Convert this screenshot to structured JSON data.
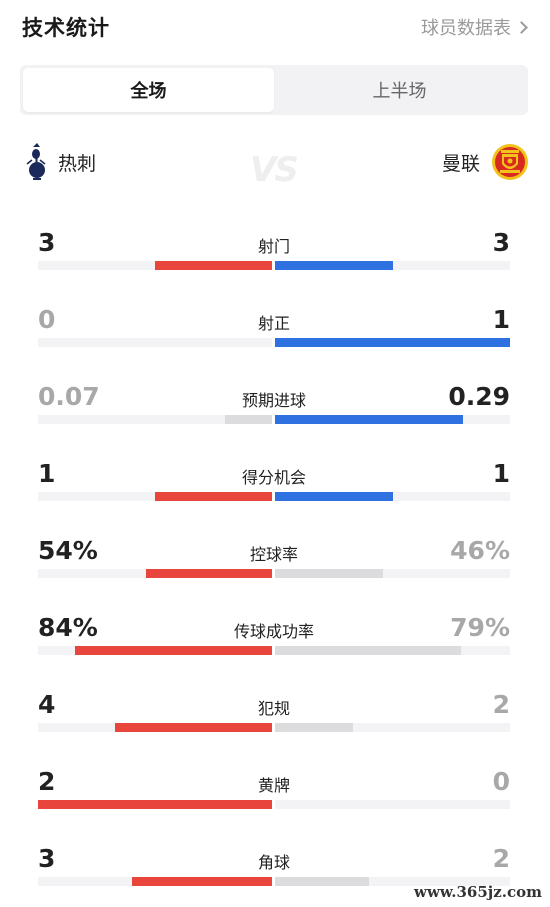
{
  "header": {
    "title": "技术统计",
    "players_link": "球员数据表"
  },
  "tabs": [
    {
      "label": "全场",
      "active": true
    },
    {
      "label": "上半场",
      "active": false
    }
  ],
  "teams": {
    "home": "热刺",
    "away": "曼联",
    "vs": "VS"
  },
  "colors": {
    "home_win": "#e8453c",
    "away_win": "#2f71e0",
    "lose_bar": "#dcdcdf",
    "win_text": "#222222",
    "lose_text": "#a8a8a8"
  },
  "stats": [
    {
      "label": "射门",
      "home": "3",
      "away": "3",
      "home_frac": 0.5,
      "away_frac": 0.5,
      "lead": "tie"
    },
    {
      "label": "射正",
      "home": "0",
      "away": "1",
      "home_frac": 0.0,
      "away_frac": 1.0,
      "lead": "away"
    },
    {
      "label": "预期进球",
      "home": "0.07",
      "away": "0.29",
      "home_frac": 0.2,
      "away_frac": 0.8,
      "lead": "away"
    },
    {
      "label": "得分机会",
      "home": "1",
      "away": "1",
      "home_frac": 0.5,
      "away_frac": 0.5,
      "lead": "tie"
    },
    {
      "label": "控球率",
      "home": "54%",
      "away": "46%",
      "home_frac": 0.54,
      "away_frac": 0.46,
      "lead": "home"
    },
    {
      "label": "传球成功率",
      "home": "84%",
      "away": "79%",
      "home_frac": 0.84,
      "away_frac": 0.79,
      "lead": "home"
    },
    {
      "label": "犯规",
      "home": "4",
      "away": "2",
      "home_frac": 0.67,
      "away_frac": 0.33,
      "lead": "home"
    },
    {
      "label": "黄牌",
      "home": "2",
      "away": "0",
      "home_frac": 1.0,
      "away_frac": 0.0,
      "lead": "home"
    },
    {
      "label": "角球",
      "home": "3",
      "away": "2",
      "home_frac": 0.6,
      "away_frac": 0.4,
      "lead": "home"
    }
  ],
  "watermark": "www.365jz.com"
}
